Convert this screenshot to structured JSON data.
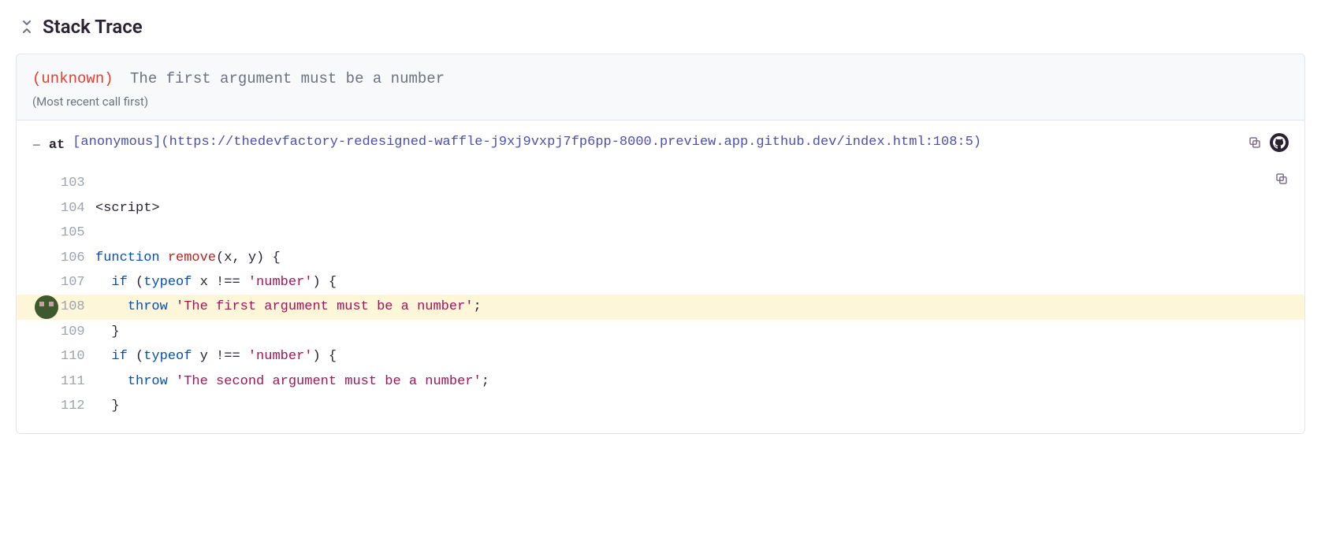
{
  "header": {
    "title": "Stack Trace"
  },
  "panel": {
    "unknown_label": "(unknown)",
    "error_message": "The first argument must be a number",
    "subtitle": "(Most recent call first)"
  },
  "frame": {
    "toggle": "−",
    "at": "at",
    "link_text": "[anonymous](https://thedevfactory-redesigned-waffle-j9xj9vxpj7fp6pp-8000.preview.app.github.dev/index.html:108:5)"
  },
  "code": {
    "lines": [
      {
        "num": "103",
        "highlight": false,
        "tokens": []
      },
      {
        "num": "104",
        "highlight": false,
        "tokens": [
          {
            "t": "plain",
            "v": "<script>"
          }
        ]
      },
      {
        "num": "105",
        "highlight": false,
        "tokens": []
      },
      {
        "num": "106",
        "highlight": false,
        "tokens": [
          {
            "t": "kw",
            "v": "function"
          },
          {
            "t": "plain",
            "v": " "
          },
          {
            "t": "fn",
            "v": "remove"
          },
          {
            "t": "plain",
            "v": "(x, y) {"
          }
        ]
      },
      {
        "num": "107",
        "highlight": false,
        "tokens": [
          {
            "t": "plain",
            "v": "  "
          },
          {
            "t": "kw",
            "v": "if"
          },
          {
            "t": "plain",
            "v": " ("
          },
          {
            "t": "kw",
            "v": "typeof"
          },
          {
            "t": "plain",
            "v": " x !== "
          },
          {
            "t": "str",
            "v": "'number'"
          },
          {
            "t": "plain",
            "v": ") {"
          }
        ]
      },
      {
        "num": "108",
        "highlight": true,
        "tokens": [
          {
            "t": "plain",
            "v": "    "
          },
          {
            "t": "kw",
            "v": "throw"
          },
          {
            "t": "plain",
            "v": " "
          },
          {
            "t": "str",
            "v": "'The first argument must be a number'"
          },
          {
            "t": "plain",
            "v": ";"
          }
        ]
      },
      {
        "num": "109",
        "highlight": false,
        "tokens": [
          {
            "t": "plain",
            "v": "  }"
          }
        ]
      },
      {
        "num": "110",
        "highlight": false,
        "tokens": [
          {
            "t": "plain",
            "v": "  "
          },
          {
            "t": "kw",
            "v": "if"
          },
          {
            "t": "plain",
            "v": " ("
          },
          {
            "t": "kw",
            "v": "typeof"
          },
          {
            "t": "plain",
            "v": " y !== "
          },
          {
            "t": "str",
            "v": "'number'"
          },
          {
            "t": "plain",
            "v": ") {"
          }
        ]
      },
      {
        "num": "111",
        "highlight": false,
        "tokens": [
          {
            "t": "plain",
            "v": "    "
          },
          {
            "t": "kw",
            "v": "throw"
          },
          {
            "t": "plain",
            "v": " "
          },
          {
            "t": "str",
            "v": "'The second argument must be a number'"
          },
          {
            "t": "plain",
            "v": ";"
          }
        ]
      },
      {
        "num": "112",
        "highlight": false,
        "tokens": [
          {
            "t": "plain",
            "v": "  }"
          }
        ]
      }
    ]
  }
}
